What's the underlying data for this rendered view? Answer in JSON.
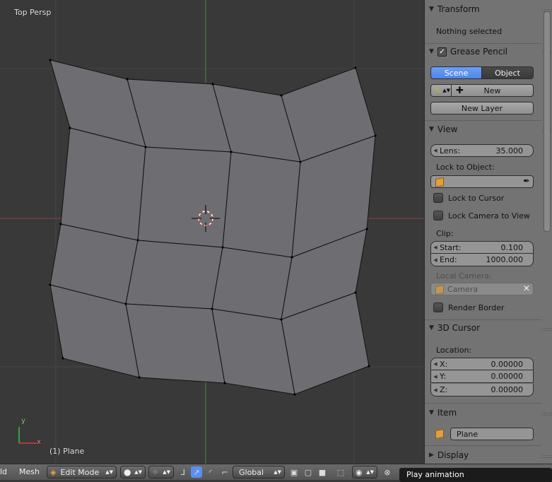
{
  "viewport": {
    "view_label": "Top Persp",
    "object_label": "(1) Plane",
    "axis_y": "y",
    "axis_x": "x"
  },
  "panel": {
    "transform": {
      "title": "Transform",
      "status": "Nothing selected"
    },
    "grease_pencil": {
      "title": "Grease Pencil",
      "tab_scene": "Scene",
      "tab_object": "Object",
      "new_label": "New",
      "new_layer_label": "New Layer"
    },
    "view": {
      "title": "View",
      "lens_label": "Lens:",
      "lens_value": "35.000",
      "lock_object_label": "Lock to Object:",
      "lock_cursor_label": "Lock to Cursor",
      "lock_camera_label": "Lock Camera to View",
      "clip_label": "Clip:",
      "start_label": "Start:",
      "start_value": "0.100",
      "end_label": "End:",
      "end_value": "1000.000",
      "local_camera_label": "Local Camera:",
      "camera_placeholder": "Camera",
      "render_border_label": "Render Border"
    },
    "cursor_3d": {
      "title": "3D Cursor",
      "location_label": "Location:",
      "x_label": "X:",
      "x_value": "0.00000",
      "y_label": "Y:",
      "y_value": "0.00000",
      "z_label": "Z:",
      "z_value": "0.00000"
    },
    "item": {
      "title": "Item",
      "name": "Plane"
    },
    "display": {
      "title": "Display"
    }
  },
  "header": {
    "partial_menu": "ld",
    "mesh_menu": "Mesh",
    "mode": "Edit Mode",
    "orientation": "Global"
  },
  "tooltip": "Play animation",
  "colors": {
    "viewport_bg": "#393939",
    "mesh_face": "#6e6e72",
    "panel_bg": "#737373",
    "selected_tab": "#5a8ff0",
    "axis_green": "#3f8f3f",
    "axis_red": "#8f3f3f"
  }
}
